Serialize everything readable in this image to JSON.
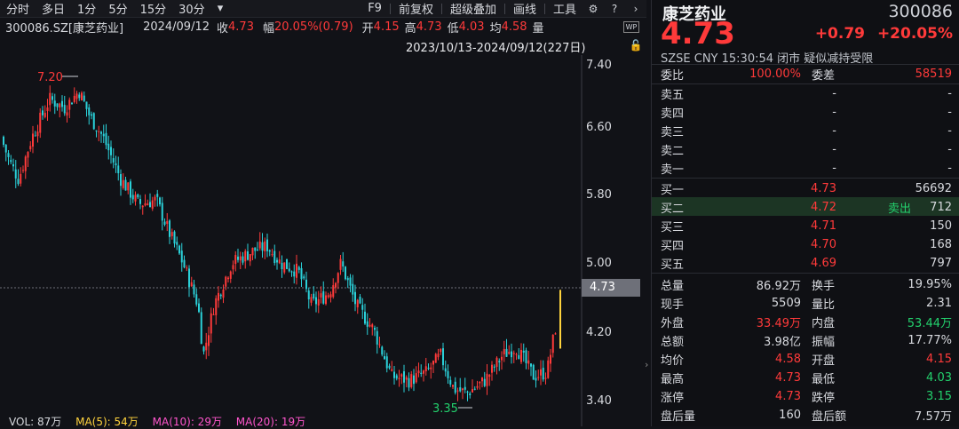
{
  "toolbar": {
    "left_items": [
      "分时",
      "多日",
      "1分",
      "5分",
      "15分",
      "30分"
    ],
    "dropdown": "▾",
    "right_items": [
      "F9",
      "前复权",
      "超级叠加",
      "画线",
      "工具"
    ]
  },
  "info": {
    "code": "300086.SZ[康芝药业]",
    "date": "2024/09/12",
    "close_label": "收",
    "close": "4.73",
    "amp_label": "幅",
    "amp": "20.05%(0.79)",
    "open_label": "开",
    "open": "4.15",
    "high_label": "高",
    "high": "4.73",
    "low_label": "低",
    "low": "4.03",
    "avg_label": "均",
    "avg": "4.58",
    "vol_label": "量"
  },
  "range": "2023/10/13-2024/09/12(227日)",
  "axis": {
    "labels": [
      "7.40",
      "6.60",
      "5.80",
      "5.00",
      "4.20",
      "3.40"
    ]
  },
  "chart_marks": {
    "high_label": "7.20",
    "low_label": "3.35"
  },
  "current_price_tag": "4.73",
  "vol_line": {
    "vol": "VOL: 87万",
    "ma5": "MA(5): 54万",
    "ma10": "MA(10): 29万",
    "ma20": "MA(20): 19万"
  },
  "colors": {
    "up": "#ff3a3a",
    "down": "#2ad0d8",
    "bg": "#111217"
  },
  "quote": {
    "name": "康芝药业",
    "code": "300086",
    "price": "4.73",
    "change": "+0.79",
    "change_pct": "+20.05%",
    "meta": "SZSE  CNY  15:30:54  闭市  疑似减持受限",
    "weibi_label": "委比",
    "weibi": "100.00%",
    "weicha_label": "委差",
    "weicha": "58519",
    "asks": [
      {
        "label": "卖五",
        "price": "-",
        "vol": "-"
      },
      {
        "label": "卖四",
        "price": "-",
        "vol": "-"
      },
      {
        "label": "卖三",
        "price": "-",
        "vol": "-"
      },
      {
        "label": "卖二",
        "price": "-",
        "vol": "-"
      },
      {
        "label": "卖一",
        "price": "-",
        "vol": "-"
      }
    ],
    "bids": [
      {
        "label": "买一",
        "price": "4.73",
        "tag": "",
        "vol": "56692"
      },
      {
        "label": "买二",
        "price": "4.72",
        "tag": "卖出",
        "vol": "712"
      },
      {
        "label": "买三",
        "price": "4.71",
        "tag": "",
        "vol": "150"
      },
      {
        "label": "买四",
        "price": "4.70",
        "tag": "",
        "vol": "168"
      },
      {
        "label": "买五",
        "price": "4.69",
        "tag": "",
        "vol": "797"
      }
    ],
    "stats": [
      {
        "l1": "总量",
        "v1": "86.92万",
        "c1": "",
        "l2": "换手",
        "v2": "19.95%",
        "c2": ""
      },
      {
        "l1": "现手",
        "v1": "5509",
        "c1": "",
        "l2": "量比",
        "v2": "2.31",
        "c2": ""
      },
      {
        "l1": "外盘",
        "v1": "33.49万",
        "c1": "red",
        "l2": "内盘",
        "v2": "53.44万",
        "c2": "green"
      },
      {
        "l1": "总额",
        "v1": "3.98亿",
        "c1": "",
        "l2": "振幅",
        "v2": "17.77%",
        "c2": ""
      },
      {
        "l1": "均价",
        "v1": "4.58",
        "c1": "red",
        "l2": "开盘",
        "v2": "4.15",
        "c2": "red"
      },
      {
        "l1": "最高",
        "v1": "4.73",
        "c1": "red",
        "l2": "最低",
        "v2": "4.03",
        "c2": "green"
      },
      {
        "l1": "涨停",
        "v1": "4.73",
        "c1": "red",
        "l2": "跌停",
        "v2": "3.15",
        "c2": "green"
      },
      {
        "l1": "盘后量",
        "v1": "160",
        "c1": "",
        "l2": "盘后额",
        "v2": "7.57万",
        "c2": ""
      }
    ]
  },
  "chart_data": {
    "type": "candlestick",
    "y_range": [
      3.4,
      7.4
    ],
    "y_ticks": [
      7.4,
      6.6,
      5.8,
      5.0,
      4.2,
      3.4
    ],
    "period": "2023/10/13-2024/09/12",
    "days": 227,
    "marked_high": 7.2,
    "marked_low": 3.35,
    "last_close": 4.73
  }
}
